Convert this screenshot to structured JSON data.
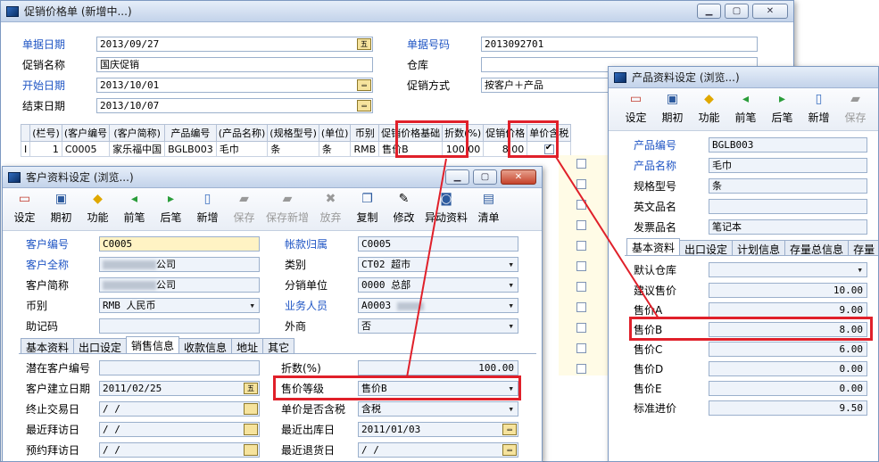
{
  "promo": {
    "title": "促销价格单 (新增中...)",
    "bill_date_label": "单据日期",
    "bill_date": "2013/09/27",
    "bill_no_label": "单据号码",
    "bill_no": "2013092701",
    "promo_name_label": "促销名称",
    "promo_name": "国庆促销",
    "warehouse_label": "仓库",
    "warehouse": "",
    "start_label": "开始日期",
    "start": "2013/10/01",
    "method_label": "促销方式",
    "method": "按客户＋产品",
    "end_label": "结束日期",
    "end": "2013/10/07",
    "columns": [
      "(栏号)",
      "(客户编号",
      "(客户简称)",
      "产品编号",
      "(产品名称)",
      "(规格型号)",
      "(单位)",
      "币别",
      "促销价格基础",
      "折数(%)",
      "促销价格",
      "单价含税"
    ],
    "rows": [
      {
        "marker": "I",
        "no": "1",
        "cust_code": "C0005",
        "cust_name": "家乐福中国",
        "prod_code": "BGLB003",
        "prod_name": "毛巾",
        "spec": "条",
        "unit": "条",
        "currency": "RMB",
        "basis": "售价B",
        "discount": "100.00",
        "price": "8.00"
      }
    ]
  },
  "customer": {
    "title": "客户资料设定 (浏览...)",
    "toolbar": [
      {
        "label": "设定",
        "icon": "settings-icon",
        "enabled": true
      },
      {
        "label": "期初",
        "icon": "opening-icon",
        "enabled": true
      },
      {
        "label": "功能",
        "icon": "function-icon",
        "enabled": true
      },
      {
        "label": "前笔",
        "icon": "prev-icon",
        "enabled": true
      },
      {
        "label": "后笔",
        "icon": "next-icon",
        "enabled": true
      },
      {
        "label": "新增",
        "icon": "new-icon",
        "enabled": true
      },
      {
        "label": "保存",
        "icon": "save-icon",
        "enabled": false
      },
      {
        "label": "保存新增",
        "icon": "save-new-icon",
        "enabled": false
      },
      {
        "label": "放弃",
        "icon": "discard-icon",
        "enabled": false
      },
      {
        "label": "复制",
        "icon": "copy-icon",
        "enabled": true
      },
      {
        "label": "修改",
        "icon": "edit-icon",
        "enabled": true
      },
      {
        "label": "异动资料",
        "icon": "history-icon",
        "enabled": true
      },
      {
        "label": "清单",
        "icon": "list-icon",
        "enabled": true
      }
    ],
    "code_label": "客户编号",
    "code": "C0005",
    "account_label": "帐款归属",
    "account": "C0005",
    "fullname_label": "客户全称",
    "fullname": "公司",
    "category_label": "类别",
    "category": "CT02 超市",
    "shortname_label": "客户简称",
    "shortname": "公司",
    "branch_label": "分销单位",
    "branch": "0000 总部",
    "currency_label": "币别",
    "currency": "RMB 人民币",
    "sales_label": "业务人员",
    "sales": "A0003",
    "memo_label": "助记码",
    "memo": "",
    "foreign_label": "外商",
    "foreign": "否",
    "tabs": [
      "基本资料",
      "出口设定",
      "销售信息",
      "收款信息",
      "地址",
      "其它"
    ],
    "active_tab": 2,
    "potential_label": "潜在客户编号",
    "potential": "",
    "discount_label": "折数(%)",
    "discount": "100.00",
    "created_label": "客户建立日期",
    "created": "2011/02/25",
    "price_level_label": "售价等级",
    "price_level": "售价B",
    "last_trade_label": "终止交易日",
    "last_trade": "/ /",
    "tax_label": "单价是否含税",
    "tax": "含税",
    "recent_visit_label": "最近拜访日",
    "recent_visit": "/ /",
    "recent_ship_label": "最近出库日",
    "recent_ship": "2011/01/03",
    "appt_label": "预约拜访日",
    "appt": "/ /",
    "recent_return_label": "最近退货日",
    "recent_return": "/ /"
  },
  "product": {
    "title": "产品资料设定 (浏览...)",
    "toolbar": [
      {
        "label": "设定",
        "icon": "settings-icon",
        "enabled": true
      },
      {
        "label": "期初",
        "icon": "opening-icon",
        "enabled": true
      },
      {
        "label": "功能",
        "icon": "function-icon",
        "enabled": true
      },
      {
        "label": "前笔",
        "icon": "prev-icon",
        "enabled": true
      },
      {
        "label": "后笔",
        "icon": "next-icon",
        "enabled": true
      },
      {
        "label": "新增",
        "icon": "new-icon",
        "enabled": true
      },
      {
        "label": "保存",
        "icon": "save-icon",
        "enabled": false
      }
    ],
    "code_label": "产品编号",
    "code": "BGLB003",
    "name_label": "产品名称",
    "name": "毛巾",
    "spec_label": "规格型号",
    "spec": "条",
    "en_label": "英文品名",
    "en": "",
    "invoice_label": "发票品名",
    "invoice": "笔记本",
    "tabs": [
      "基本资料",
      "出口设定",
      "计划信息",
      "存量总信息",
      "存量"
    ],
    "warehouse_label": "默认仓库",
    "warehouse": "",
    "prices": [
      {
        "label": "建议售价",
        "value": "10.00"
      },
      {
        "label": "售价A",
        "value": "9.00"
      },
      {
        "label": "售价B",
        "value": "8.00"
      },
      {
        "label": "售价C",
        "value": "6.00"
      },
      {
        "label": "售价D",
        "value": "0.00"
      },
      {
        "label": "售价E",
        "value": "0.00"
      },
      {
        "label": "标准进价",
        "value": "9.50"
      }
    ]
  },
  "colors": {
    "highlight": "#e0202a",
    "link_label": "#1f55c4",
    "title_gradient": "#c3d3ea"
  }
}
